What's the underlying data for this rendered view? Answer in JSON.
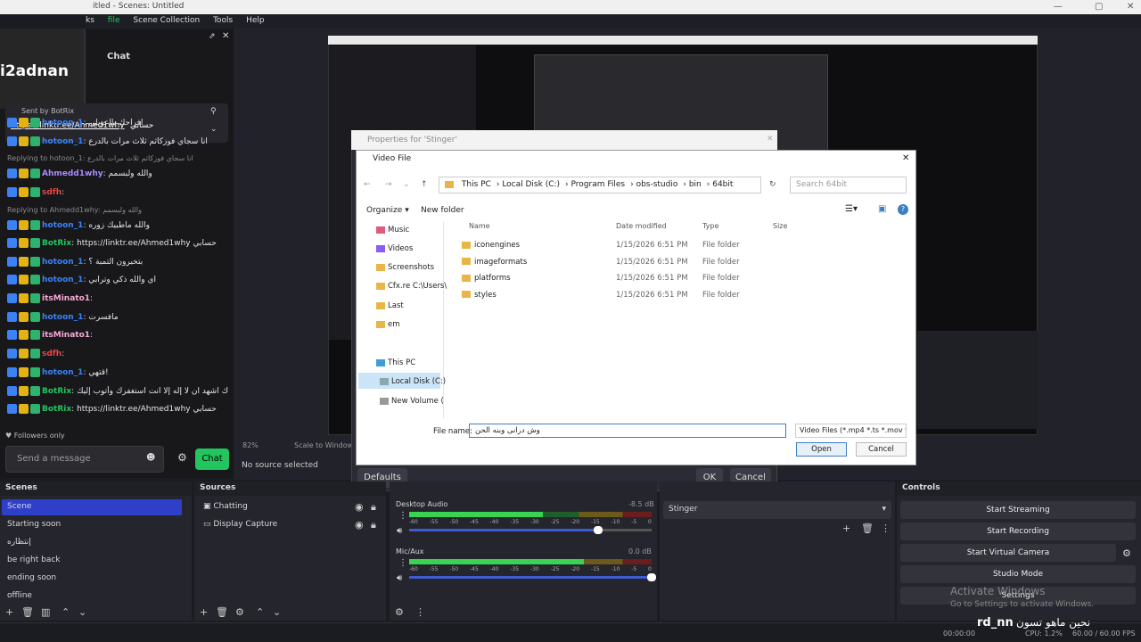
{
  "window": {
    "title": "itled - Scenes: Untitled",
    "menu": [
      "ks",
      "file",
      "Scene Collection",
      "Tools",
      "Help"
    ]
  },
  "chat": {
    "streamer": "i2adnan",
    "header": "Chat",
    "pinned_label": "Sent by BotRix",
    "pinned_link": "https://linktr.ee/Ahmed1why",
    "pinned_suffix": "حسابي",
    "lines": [
      {
        "kind": "msg",
        "user": "hotoon_1",
        "color": "#3b82f6",
        "text": "افراحك يااعويلي"
      },
      {
        "kind": "msg",
        "user": "hotoon_1",
        "color": "#3b82f6",
        "text": "انا سجاي فوزكاثم ثلاث مرات بالدرع"
      },
      {
        "kind": "reply",
        "text": "Replying to hotoon_1: انا سجاي فوزكاثم ثلاث مرات بالدرع"
      },
      {
        "kind": "msg",
        "user": "Ahmedd1why",
        "color": "#a78bfa",
        "text": "والله ولبسمم"
      },
      {
        "kind": "msg",
        "user": "sdfh",
        "color": "#ef4444",
        "text": ""
      },
      {
        "kind": "reply",
        "text": "Replying to Ahmedd1why: والله ولبسمم"
      },
      {
        "kind": "msg",
        "user": "hotoon_1",
        "color": "#3b82f6",
        "text": "والله ماطبيك زوره"
      },
      {
        "kind": "msg",
        "user": "BotRix",
        "color": "#22c55e",
        "text": "https://linktr.ee/Ahmed1why حسابي"
      },
      {
        "kind": "msg",
        "user": "hotoon_1",
        "color": "#3b82f6",
        "text": "بتخبرون التمبة ؟"
      },
      {
        "kind": "msg",
        "user": "hotoon_1",
        "color": "#3b82f6",
        "text": "اي والله ذكي وترابي"
      },
      {
        "kind": "msg",
        "user": "itsMinato1",
        "color": "#f9a8d4",
        "text": ""
      },
      {
        "kind": "msg",
        "user": "hotoon_1",
        "color": "#3b82f6",
        "text": "مافسرت"
      },
      {
        "kind": "msg",
        "user": "itsMinato1",
        "color": "#f9a8d4",
        "text": ""
      },
      {
        "kind": "msg",
        "user": "sdfh",
        "color": "#ef4444",
        "text": ""
      },
      {
        "kind": "msg",
        "user": "hotoon_1",
        "color": "#3b82f6",
        "text": "قتهي!"
      },
      {
        "kind": "msg",
        "user": "BotRix",
        "color": "#22c55e",
        "text": "سبحانك اللهم وبحمدك اشهد ان لا إله إلا انت استغفرك وأتوب إليك"
      },
      {
        "kind": "msg",
        "user": "BotRix",
        "color": "#22c55e",
        "text": "https://linktr.ee/Ahmed1why حسابي"
      }
    ],
    "followers_only": "Followers only",
    "input_placeholder": "Send a message",
    "chat_button": "Chat"
  },
  "preview": {
    "zoom": "82%",
    "scale": "Scale to Window",
    "no_source": "No source selected"
  },
  "properties": {
    "title": "Properties for 'Stinger'",
    "defaults": "Defaults",
    "ok": "OK",
    "cancel": "Cancel"
  },
  "file_dialog": {
    "title": "Video File",
    "path": [
      "This PC",
      "Local Disk (C:)",
      "Program Files",
      "obs-studio",
      "bin",
      "64bit"
    ],
    "search_placeholder": "Search 64bit",
    "organize": "Organize",
    "new_folder": "New folder",
    "nav": [
      "Music",
      "Videos",
      "Screenshots",
      "Cfx.re C:\\Users\\",
      "Last",
      "em",
      "This PC",
      "Local Disk (C:)",
      "New Volume ("
    ],
    "columns": [
      "Name",
      "Date modified",
      "Type",
      "Size"
    ],
    "files": [
      {
        "name": "iconengines",
        "date": "1/15/2026 6:51 PM",
        "type": "File folder"
      },
      {
        "name": "imageformats",
        "date": "1/15/2026 6:51 PM",
        "type": "File folder"
      },
      {
        "name": "platforms",
        "date": "1/15/2026 6:51 PM",
        "type": "File folder"
      },
      {
        "name": "styles",
        "date": "1/15/2026 6:51 PM",
        "type": "File folder"
      }
    ],
    "filename_label": "File name:",
    "filename_value": "وش درانى وبنه الحن",
    "filetype": "Video Files (*.mp4 *.ts *.mov *.",
    "open": "Open",
    "cancel": "Cancel"
  },
  "scenes": {
    "title": "Scenes",
    "items": [
      "Scene",
      "Starting soon",
      "إنتظاره",
      "be right  back",
      "ending soon",
      "offline"
    ]
  },
  "sources": {
    "title": "Sources",
    "items": [
      "Chatting",
      "Display Capture"
    ]
  },
  "audio": {
    "channels": [
      {
        "name": "Desktop Audio",
        "db": "-8.5 dB",
        "level": 0.55,
        "volume": 0.78
      },
      {
        "name": "Mic/Aux",
        "db": "0.0 dB",
        "level": 0.72,
        "volume": 1.0
      }
    ],
    "ticks": [
      "-60",
      "-55",
      "-50",
      "-45",
      "-40",
      "-35",
      "-30",
      "-25",
      "-20",
      "-15",
      "-10",
      "-5",
      "0"
    ]
  },
  "transitions": {
    "selected": "Stinger"
  },
  "controls": {
    "title": "Controls",
    "buttons": [
      "Start Streaming",
      "Start Recording",
      "Start Virtual Camera",
      "Studio Mode",
      "Settings"
    ],
    "watermark_title": "Activate Windows",
    "watermark_sub": "Go to Settings to activate Windows."
  },
  "status": {
    "time": "00:00:00",
    "cpu": "CPU: 1.2%",
    "fps": "60.00 / 60.00 FPS",
    "overlay_name": "rd_nn",
    "overlay_text": "نحين ماهو تسون"
  }
}
